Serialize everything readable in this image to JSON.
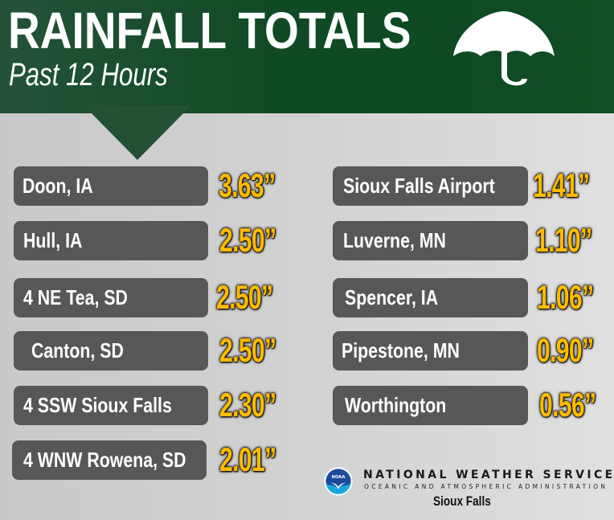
{
  "header": {
    "title": "RAINFALL TOTALS",
    "subtitle": "Past 12 Hours",
    "icon": "umbrella-icon",
    "colors": {
      "header_green": "#0e4a22",
      "pointer_green": "#245036"
    }
  },
  "colors": {
    "box": "#575757",
    "label_text": "#ffffff",
    "value_text": "#fdbb00"
  },
  "left_column": [
    {
      "location": "Doon, IA",
      "amount": "3.63”"
    },
    {
      "location": "Hull, IA",
      "amount": "2.50”"
    },
    {
      "location": "4 NE Tea, SD",
      "amount": "2.50”"
    },
    {
      "location": "Canton, SD",
      "amount": "2.50”"
    },
    {
      "location": "4 SSW Sioux Falls",
      "amount": "2.30”"
    },
    {
      "location": "4 WNW Rowena, SD",
      "amount": "2.01”"
    }
  ],
  "right_column": [
    {
      "location": "Sioux Falls Airport",
      "amount": "1.41”"
    },
    {
      "location": "Luverne, MN",
      "amount": "1.10”"
    },
    {
      "location": "Spencer, IA",
      "amount": "1.06”"
    },
    {
      "location": "Pipestone, MN",
      "amount": "0.90”"
    },
    {
      "location": "Worthington",
      "amount": "0.56”"
    }
  ],
  "footer": {
    "logo_icon": "noaa-logo-icon",
    "logo_text": "NOAA",
    "agency": "NATIONAL WEATHER SERVICE",
    "parent": "OCEANIC AND ATMOSPHERIC ADMINISTRATION",
    "office": "Sioux Falls"
  }
}
